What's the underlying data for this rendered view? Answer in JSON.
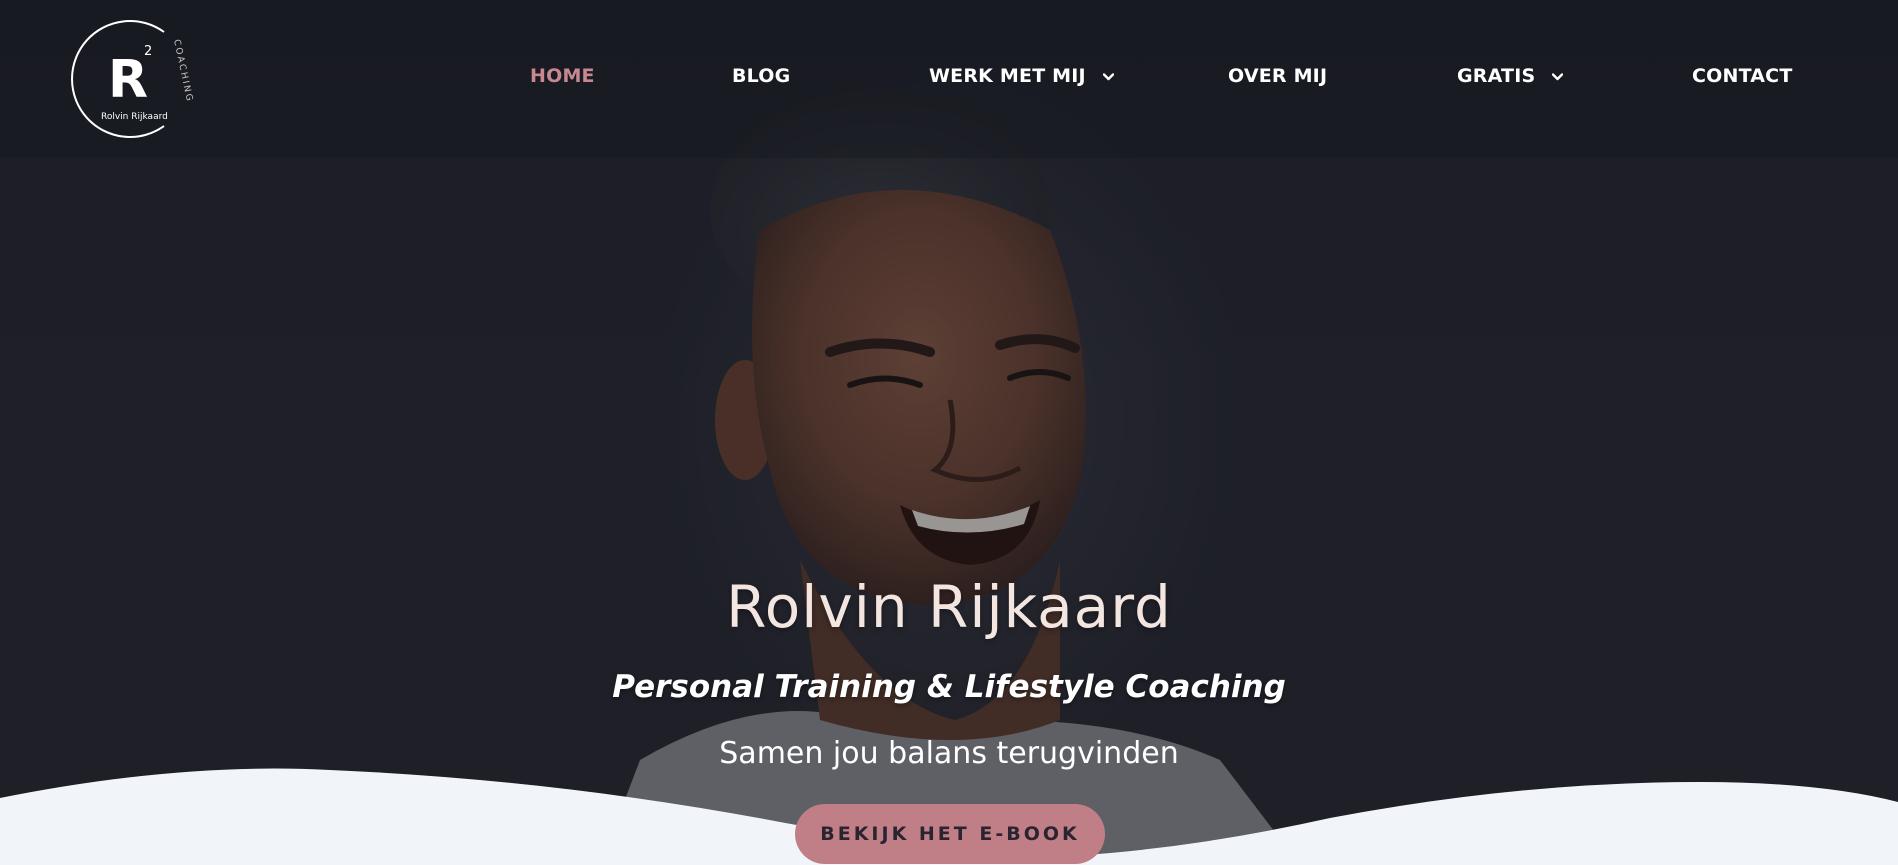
{
  "logo": {
    "mark": "R",
    "superscript": "2",
    "arc_text": "COACHING",
    "name": "Rolvin Rijkaard"
  },
  "nav": {
    "items": [
      {
        "label": "HOME",
        "active": true
      },
      {
        "label": "BLOG"
      },
      {
        "label": "WERK MET MIJ",
        "has_dropdown": true
      },
      {
        "label": "OVER MIJ"
      },
      {
        "label": "GRATIS",
        "has_dropdown": true
      },
      {
        "label": "CONTACT"
      }
    ],
    "active_color": "#c88892"
  },
  "hero": {
    "title": "Rolvin Rijkaard",
    "subtitle": "Personal Training & Lifestyle Coaching",
    "tagline": "Samen jou balans terugvinden",
    "cta_label": "BEKIJK HET E-BOOK",
    "cta_color": "#c07f86"
  },
  "icons": {
    "dropdown": "chevron-down-icon"
  }
}
